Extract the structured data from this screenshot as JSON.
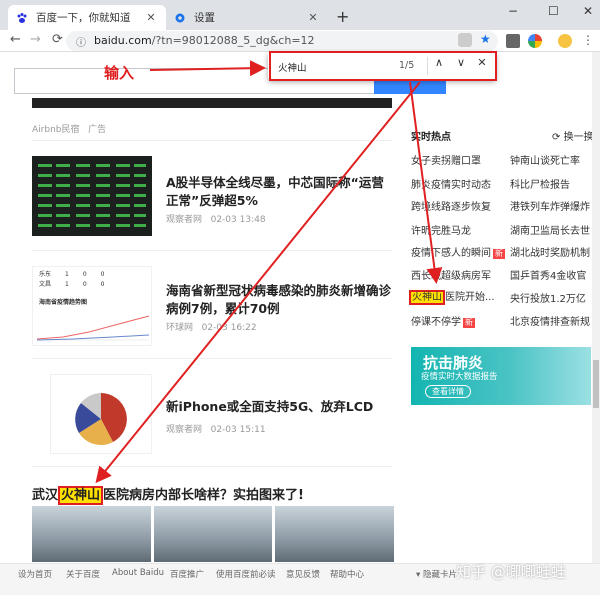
{
  "browser": {
    "tabs": [
      {
        "label": "百度一下，你就知道",
        "icon": "paw-icon",
        "active": true
      },
      {
        "label": "设置",
        "icon": "gear-icon",
        "active": false
      }
    ],
    "new_tab": "+",
    "controls": {
      "minimize": "−",
      "maximize": "☐",
      "close": "✕"
    },
    "url_host": "baidu.com",
    "url_path": "/?tn=98012088_5_dg&ch=12",
    "nav": {
      "back": "←",
      "forward": "→",
      "reload": "⟳"
    }
  },
  "find_bar": {
    "query": "火神山",
    "count": "1/5",
    "prev": "∧",
    "next": "∨",
    "close": "✕"
  },
  "annotation": {
    "input_label": "输入"
  },
  "feed": {
    "ad_source": "Airbnb民宿",
    "ad_tag": "广告",
    "items": [
      {
        "title": "A股半导体全线尽墨，中芯国际称“运营正常”反弹超5%",
        "source": "观察者网",
        "time": "02-03 13:48"
      },
      {
        "title": "海南省新型冠状病毒感染的肺炎新增确诊病例7例，累计70例",
        "source": "环球网",
        "time": "02-03 16:22"
      },
      {
        "title": "新iPhone或全面支持5G、放弃LCD",
        "source": "观察者网",
        "time": "02-03 15:11"
      }
    ],
    "big_title_pre": "武汉",
    "big_title_hl": "火神山",
    "big_title_post": "医院病房内部长啥样？实拍图来了!",
    "thumb2_rows": [
      [
        "乐东",
        "1",
        "0",
        "0"
      ],
      [
        "文昌",
        "1",
        "0",
        "0"
      ]
    ],
    "thumb2_chart_title": "海南省疫情趋势图"
  },
  "hot": {
    "title": "实时热点",
    "refresh": "换一换",
    "left": [
      "女子卖拐赠口罩",
      "肺炎疫情实时动态",
      "跨境线路逐步恢复",
      "许昕完胜马龙",
      "疫情下感人的瞬间",
      "西长城超级病房军",
      "火神山医院开始...",
      "停课不停学"
    ],
    "right": [
      "钟南山谈死亡率",
      "科比尸检报告",
      "港铁列车炸弹爆炸",
      "湖南卫监局长去世",
      "湖北战时奖励机制",
      "国乒首秀4金收官",
      "央行投放1.2万亿",
      "北京疫情排查新规"
    ],
    "new_badge": "新",
    "hl_item_prefix": "火神山",
    "hl_item_rest": "医院开始..."
  },
  "ad": {
    "title": "抗击肺炎",
    "subtitle": "疫情实时大数据报告",
    "button": "查看详情"
  },
  "footer": {
    "links": [
      "设为首页",
      "关于百度",
      "About Baidu",
      "百度推广",
      "使用百度前必读",
      "意见反馈",
      "帮助中心"
    ],
    "collapse": "隐藏卡片",
    "watermark": "知乎 @唧唧蛙蛙"
  },
  "colors": {
    "highlight": "#ffe000",
    "annotation": "#e02020",
    "baidu_blue": "#3385ff"
  }
}
